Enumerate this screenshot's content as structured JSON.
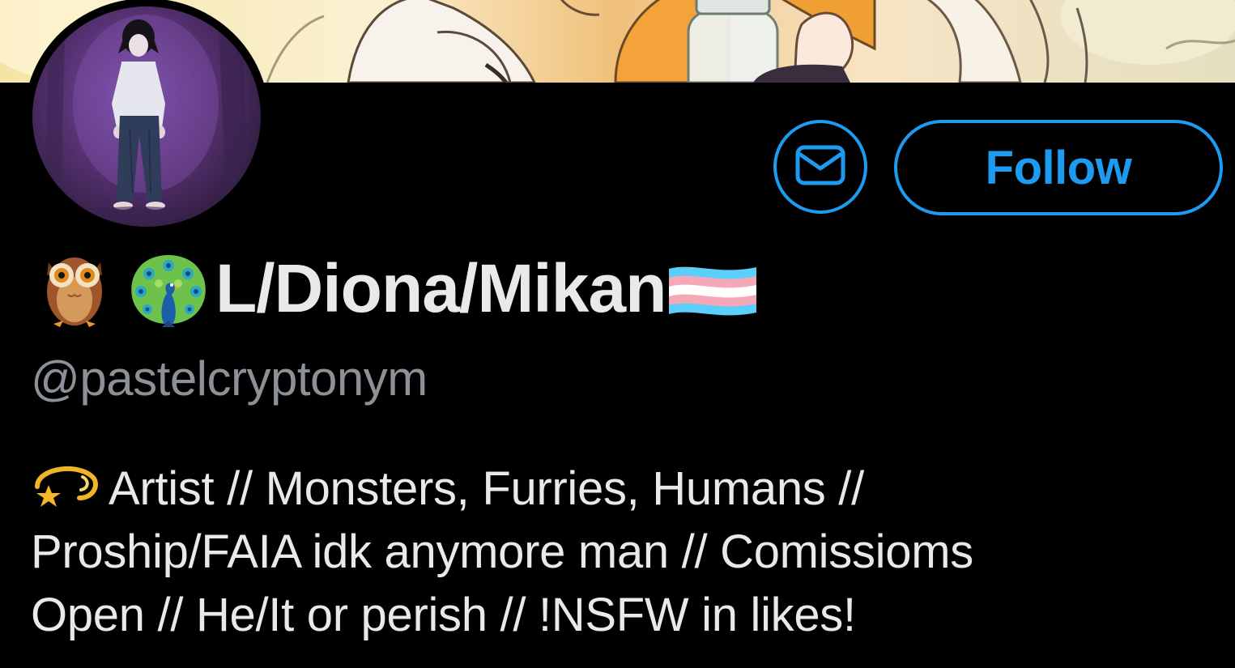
{
  "profile": {
    "display_name": "L/Diona/Mikan",
    "name_emojis": [
      "owl-emoji",
      "peacock-emoji"
    ],
    "name_suffix_emoji": "transgender-flag-emoji",
    "handle": "@pastelcryptonym",
    "bio_emoji": "dizzy-emoji",
    "bio_lines": [
      "Artist // Monsters, Furries, Humans //",
      "Proship/FAIA idk anymore man // Comissioms",
      "Open // He/It or perish // !NSFW in likes!"
    ]
  },
  "actions": {
    "message_icon": "envelope-icon",
    "follow_label": "Follow"
  },
  "colors": {
    "background": "#000000",
    "accent": "#1d9bf0",
    "primary_text": "#e7e9ea",
    "secondary_text": "#8b9197",
    "flag_blue": "#5bcefa",
    "flag_pink": "#f5a9b8",
    "flag_white": "#ffffff"
  }
}
